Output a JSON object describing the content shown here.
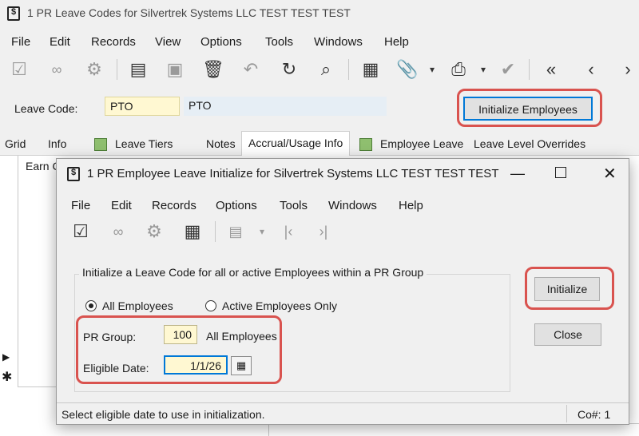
{
  "main_window": {
    "title": "1 PR Leave Codes for Silvertrek Systems LLC TEST TEST TEST",
    "menu": [
      "File",
      "Edit",
      "Records",
      "View",
      "Options",
      "Tools",
      "Windows",
      "Help"
    ],
    "leave_code_label": "Leave Code:",
    "leave_code_value": "PTO",
    "leave_code_desc": "PTO",
    "init_button": "Initialize Employees",
    "tabs": [
      "Grid",
      "Info",
      "Leave Tiers",
      "Notes",
      "Accrual/Usage Info",
      "Employee Leave",
      "Leave Level Overrides"
    ],
    "grid_header": "Earn C"
  },
  "dialog": {
    "title": "1 PR Employee Leave Initialize for Silvertrek Systems LLC TEST TEST TEST",
    "menu": [
      "File",
      "Edit",
      "Records",
      "Options",
      "Tools",
      "Windows",
      "Help"
    ],
    "group_title": "Initialize a Leave Code for all or active Employees within a PR Group",
    "radio_all": "All Employees",
    "radio_active": "Active Employees Only",
    "pr_group_label": "PR Group:",
    "pr_group_value": "100",
    "pr_group_desc": "All Employees",
    "eligible_date_label": "Eligible Date:",
    "eligible_date_value": "1/1/26",
    "initialize_button": "Initialize",
    "close_button": "Close",
    "status_text": "Select eligible date to use in initialization.",
    "company": "Co#: 1"
  },
  "colors": {
    "highlight": "#d9534f",
    "input_yellow": "#fff8d2",
    "focus_blue": "#0078d7"
  }
}
